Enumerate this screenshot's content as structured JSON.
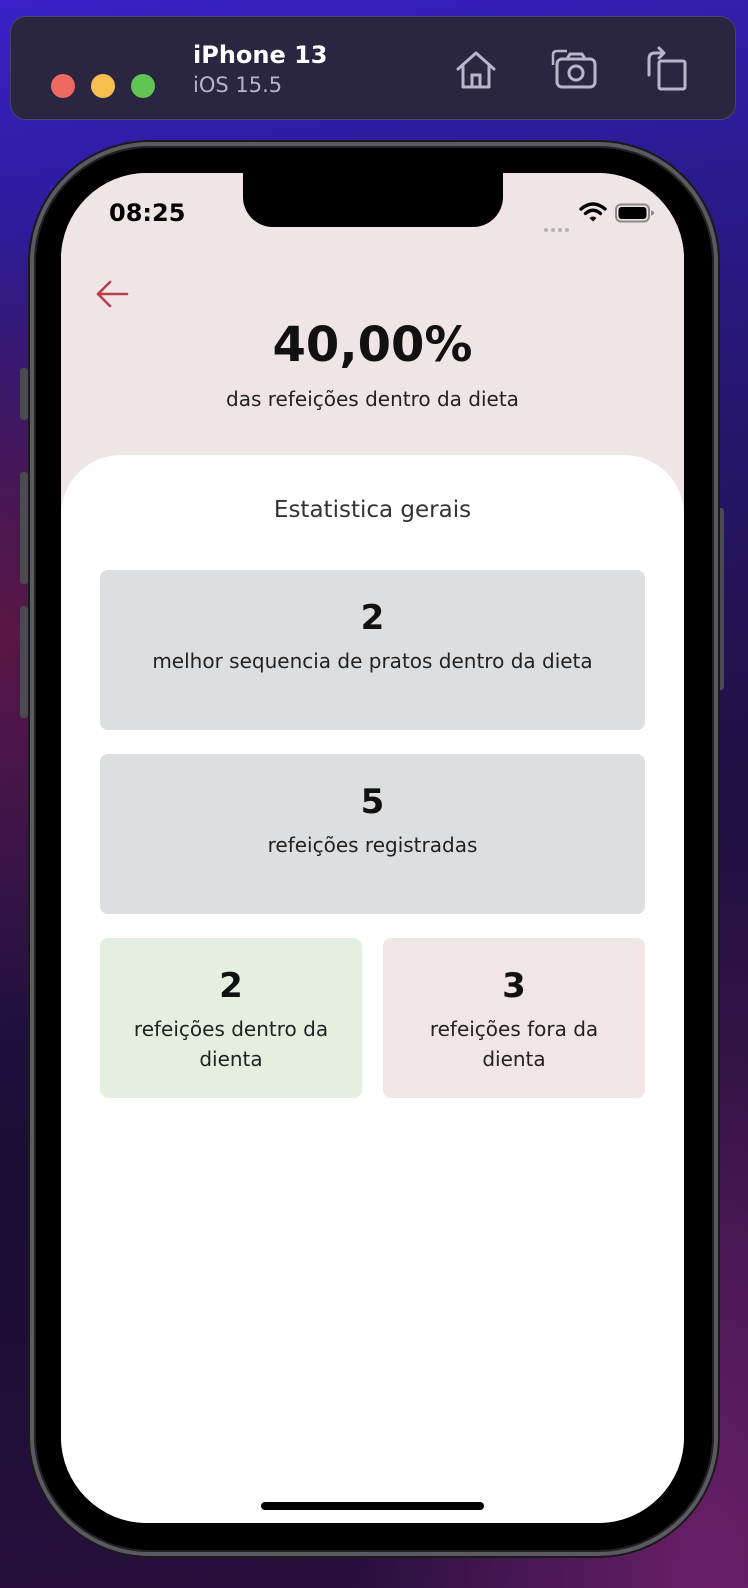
{
  "simulator": {
    "device_name": "iPhone 13",
    "os_version": "iOS 15.5",
    "toolbar_icons": [
      "home-icon",
      "screenshot-icon",
      "rotate-icon"
    ]
  },
  "status_bar": {
    "time": "08:25"
  },
  "header": {
    "back_icon": "arrow-left-icon",
    "percentage": "40,00%",
    "percentage_label": "das refeições dentro da dieta",
    "accent_color": "#b83e4d",
    "background_color": "#efe5e6"
  },
  "stats": {
    "title": "Estatistica gerais",
    "best_sequence": {
      "value": "2",
      "label": "melhor sequencia de pratos dentro da dieta"
    },
    "registered": {
      "value": "5",
      "label": "refeições registradas"
    },
    "inside_diet": {
      "value": "2",
      "label": "refeições dentro da dienta",
      "color": "#e5efdf"
    },
    "outside_diet": {
      "value": "3",
      "label": "refeições fora da dienta",
      "color": "#f1e5e5"
    }
  }
}
